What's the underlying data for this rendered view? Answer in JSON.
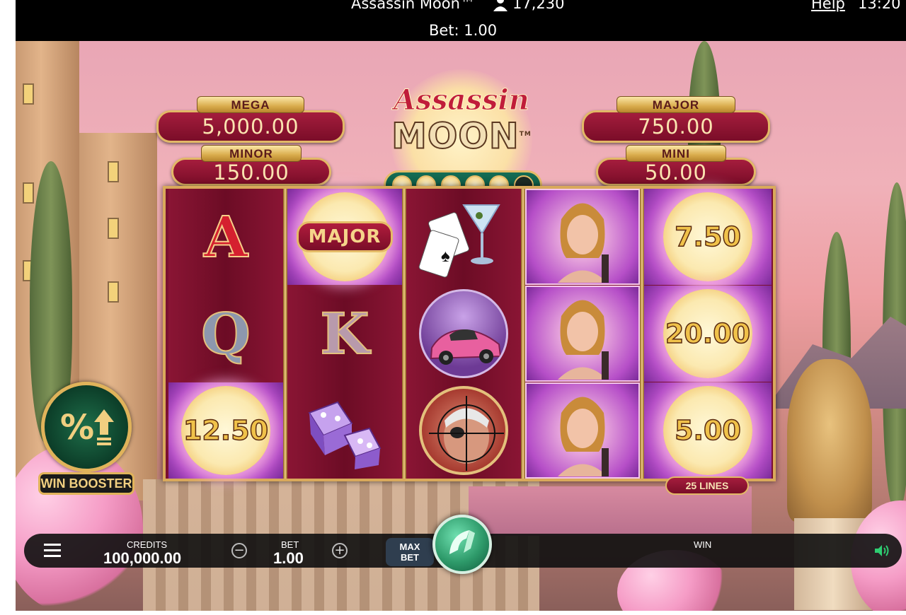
{
  "header": {
    "game_title": "Assassin Moon™",
    "player_count": "17,230",
    "help_link": "Help",
    "clock": "13:20",
    "bet_display": "Bet: 1.00"
  },
  "logo": {
    "line1": "Assassin",
    "line2": "MOON",
    "tm": "TM"
  },
  "jackpots": {
    "mega": {
      "label": "MEGA",
      "value": "5,000.00"
    },
    "minor": {
      "label": "MINOR",
      "value": "150.00"
    },
    "major": {
      "label": "MAJOR",
      "value": "750.00"
    },
    "mini": {
      "label": "MINI",
      "value": "50.00"
    }
  },
  "progress_dots": {
    "filled": 5,
    "total": 6
  },
  "reels": {
    "r1": {
      "top": "A",
      "mid": "Q",
      "bottom": "12.50"
    },
    "r2": {
      "top": "MAJOR",
      "mid": "K"
    },
    "r3": {
      "symbols": [
        "cocktail-cards-icon",
        "sports-car-icon",
        "assassin-target-icon"
      ]
    },
    "r5": {
      "top": "7.50",
      "mid": "20.00",
      "bottom": "5.00"
    }
  },
  "win_booster": {
    "label": "WIN BOOSTER",
    "icon": "percent-up-icon"
  },
  "lines_badge": "25 LINES",
  "hud": {
    "credits_label": "CREDITS",
    "credits_value": "100,000.00",
    "bet_label": "BET",
    "bet_value": "1.00",
    "minus": "−",
    "plus": "+",
    "max_bet_line1": "MAX",
    "max_bet_line2": "BET",
    "win_label": "WIN",
    "menu_icon": "hamburger-menu-icon",
    "sound_icon": "speaker-icon"
  },
  "colors": {
    "reel_bg": "#7a1030",
    "gold": "#d9a95b",
    "spin_green": "#2e9a6a"
  }
}
